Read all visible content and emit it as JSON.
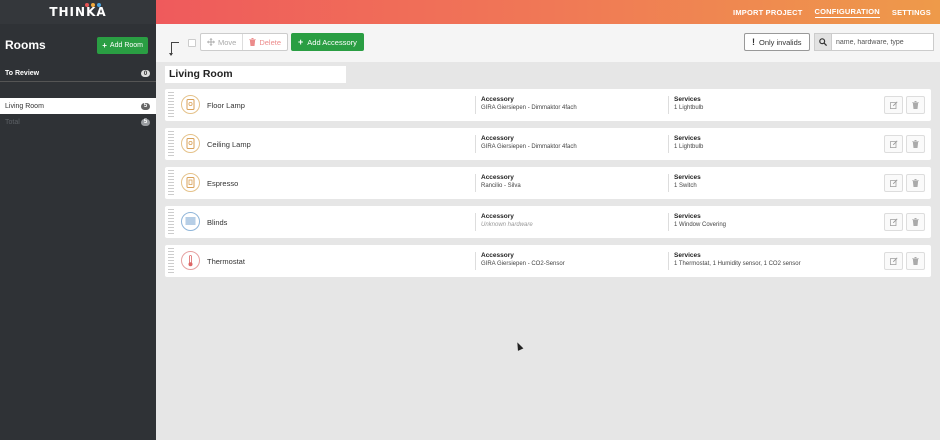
{
  "brand": {
    "name": "THINKA",
    "dot_colors": [
      "#e55454",
      "#f2a93b",
      "#4aa3df"
    ]
  },
  "nav": {
    "import": "IMPORT PROJECT",
    "configuration": "CONFIGURATION",
    "settings": "SETTINGS"
  },
  "sidebar": {
    "title": "Rooms",
    "add_room": "Add Room",
    "to_review": {
      "label": "To Review",
      "count": "0"
    },
    "rooms": [
      {
        "label": "Living Room",
        "count": "5"
      }
    ],
    "total": {
      "label": "Total",
      "count": "5"
    }
  },
  "toolbar": {
    "move": "Move",
    "delete": "Delete",
    "add_accessory": "Add Accessory",
    "only_invalids": "Only invalids",
    "search_placeholder": "name, hardware, type"
  },
  "room": {
    "title": "Living Room"
  },
  "labels": {
    "accessory": "Accessory",
    "services": "Services"
  },
  "accessories": [
    {
      "name": "Floor Lamp",
      "icon": "lightbulb-icon",
      "hardware": "GIRA Giersiepen - Dimmaktor 4fach",
      "services": "1 Lightbulb"
    },
    {
      "name": "Ceiling Lamp",
      "icon": "lightbulb-icon",
      "hardware": "GIRA Giersiepen - Dimmaktor 4fach",
      "services": "1 Lightbulb"
    },
    {
      "name": "Espresso",
      "icon": "switch-icon",
      "hardware": "Rancilio - Silva",
      "services": "1 Switch"
    },
    {
      "name": "Blinds",
      "icon": "window-covering-icon",
      "hardware": "Unknown hardware",
      "services": "1 Window Covering"
    },
    {
      "name": "Thermostat",
      "icon": "thermometer-icon",
      "hardware": "GIRA Giersiepen - CO2-Sensor",
      "services": "1 Thermostat, 1 Humidity sensor, 1 CO2 sensor"
    }
  ],
  "colors": {
    "accent_green": "#2a9e43",
    "sidebar_bg": "#2f3236",
    "topbar_start": "#ef5a5c",
    "topbar_end": "#ee9a4a"
  }
}
